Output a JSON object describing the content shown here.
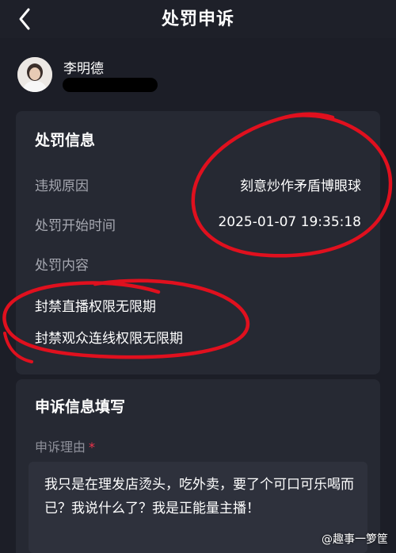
{
  "header": {
    "title": "处罚申诉",
    "back_icon": "chevron-left-icon"
  },
  "user": {
    "name": "李明德",
    "id_redacted": true
  },
  "penalty_info": {
    "section_title": "处罚信息",
    "rows": [
      {
        "label": "违规原因",
        "value": "刻意炒作矛盾博眼球"
      },
      {
        "label": "处罚开始时间",
        "value": "2025-01-07 19:35:18"
      },
      {
        "label": "处罚内容",
        "value": ""
      }
    ],
    "items": [
      "封禁直播权限无限期",
      "封禁观众连线权限无限期"
    ]
  },
  "appeal": {
    "section_title": "申诉信息填写",
    "field_label": "申诉理由",
    "required_mark": "*",
    "reason_text": "我只是在理发店烫头，吃外卖，要了个可口可乐喝而已？我说什么了？我是正能量主播！"
  },
  "watermark": "@趣事一箩筐",
  "colors": {
    "background": "#1c1e27",
    "card": "#262933",
    "annotation_red": "#e0101e",
    "required_red": "#f0334b"
  }
}
